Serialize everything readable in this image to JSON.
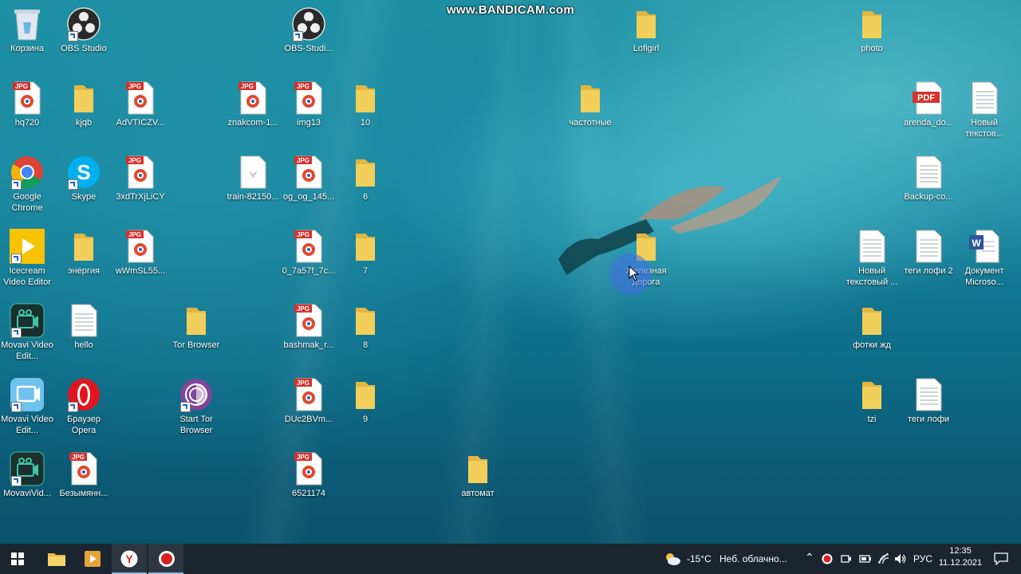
{
  "watermark": "www.BANDICAM.com",
  "desktop_icons": [
    {
      "label": "Корзина",
      "type": "recycle"
    },
    {
      "label": "OBS Studio",
      "type": "obs"
    },
    {
      "label": "OBS-Studi...",
      "type": "obs"
    },
    {
      "label": "Lofigirl",
      "type": "folder"
    },
    {
      "label": "photo",
      "type": "folder"
    },
    {
      "label": "hq720",
      "type": "jpg"
    },
    {
      "label": "kjqb",
      "type": "folder"
    },
    {
      "label": "AdVTICZV...",
      "type": "jpg"
    },
    {
      "label": "znakcom-1...",
      "type": "jpg"
    },
    {
      "label": "img13",
      "type": "jpg"
    },
    {
      "label": "10",
      "type": "folder"
    },
    {
      "label": "частотные",
      "type": "folder"
    },
    {
      "label": "arenda_do...",
      "type": "pdf"
    },
    {
      "label": "Новый текстов...",
      "type": "txt"
    },
    {
      "label": "Google Chrome",
      "type": "chrome"
    },
    {
      "label": "Skype",
      "type": "skype"
    },
    {
      "label": "3xdTrXjLiCY",
      "type": "jpg"
    },
    {
      "label": "train-82150...",
      "type": "blank"
    },
    {
      "label": "og_og_145...",
      "type": "jpg"
    },
    {
      "label": "6",
      "type": "folder"
    },
    {
      "label": "Backup-co...",
      "type": "txt"
    },
    {
      "label": "Icecream Video Editor",
      "type": "icecream"
    },
    {
      "label": "энергия",
      "type": "folder"
    },
    {
      "label": "wWmSL55...",
      "type": "jpg"
    },
    {
      "label": "0_7a57f_7c...",
      "type": "jpg"
    },
    {
      "label": "7",
      "type": "folder"
    },
    {
      "label": "Железная дорога",
      "type": "folder"
    },
    {
      "label": "Новый текстовый ...",
      "type": "txt"
    },
    {
      "label": "теги лофи 2",
      "type": "txt"
    },
    {
      "label": "Документ Microso...",
      "type": "word"
    },
    {
      "label": "Movavi Video Edit...",
      "type": "movavi"
    },
    {
      "label": "hello",
      "type": "txt"
    },
    {
      "label": "Tor Browser",
      "type": "folder"
    },
    {
      "label": "bashmak_r...",
      "type": "jpg"
    },
    {
      "label": "8",
      "type": "folder"
    },
    {
      "label": "фотки жд",
      "type": "folder"
    },
    {
      "label": "Movavi Video Edit...",
      "type": "movavi2"
    },
    {
      "label": "Браузер Opera",
      "type": "opera"
    },
    {
      "label": "Start Tor Browser",
      "type": "tor"
    },
    {
      "label": "DUc2BVm...",
      "type": "jpg"
    },
    {
      "label": "9",
      "type": "folder"
    },
    {
      "label": "tzi",
      "type": "folder"
    },
    {
      "label": "теги лофи",
      "type": "txt"
    },
    {
      "label": "MovaviVid...",
      "type": "movavi"
    },
    {
      "label": "Безымянн...",
      "type": "jpg"
    },
    {
      "label": "6521174",
      "type": "jpg"
    },
    {
      "label": "автомат",
      "type": "folder"
    }
  ],
  "badges": {
    "jpg": "JPG",
    "pdf": "PDF",
    "word": "W"
  },
  "taskbar": {
    "pinned": [
      "start-icon",
      "file-explorer-icon",
      "media-player-icon",
      "yandex-browser-icon",
      "bandicam-record-icon"
    ]
  },
  "tray": {
    "temperature": "-15°C",
    "weather": "Неб. облачно...",
    "language": "РУС",
    "time": "12:35",
    "date": "11.12.2021"
  },
  "colors": {
    "folder": "#f2cf5b",
    "taskbar": "#1a2530",
    "record_red": "#d62020"
  }
}
